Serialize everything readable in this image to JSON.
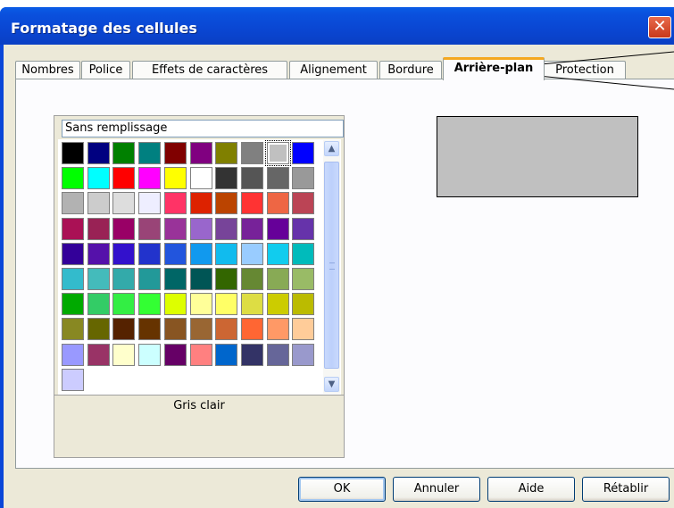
{
  "window": {
    "title": "Formatage des cellules",
    "close_symbol": "✕"
  },
  "tabs": [
    {
      "label": "Nombres",
      "active": false
    },
    {
      "label": "Police",
      "active": false
    },
    {
      "label": "Effets de caractères",
      "active": false
    },
    {
      "label": "Alignement",
      "active": false
    },
    {
      "label": "Bordure",
      "active": false
    },
    {
      "label": "Arrière-plan",
      "active": true
    },
    {
      "label": "Protection",
      "active": false
    }
  ],
  "background_tab": {
    "no_fill_label": "Sans remplissage",
    "selected_color_name": "Gris clair",
    "selected_color_hex": "#c0c0c0",
    "palette": [
      [
        "#000000",
        "#000080",
        "#008000",
        "#008080",
        "#800000",
        "#800080",
        "#808000",
        "#808080",
        "#c0c0c0",
        "#0000ff"
      ],
      [
        "#00ff00",
        "#00ffff",
        "#ff0000",
        "#ff00ff",
        "#ffff00",
        "#ffffff",
        "#333333",
        "#555555",
        "#666666",
        "#999999"
      ],
      [
        "#b2b2b2",
        "#cccccc",
        "#dddddd",
        "#eeeeff",
        "#ff3366",
        "#dd2200",
        "#bb4400",
        "#ff3333",
        "#ee6644",
        "#bb4455"
      ],
      [
        "#aa1155",
        "#992255",
        "#990066",
        "#994477",
        "#993399",
        "#9966cc",
        "#774499",
        "#772299",
        "#660099",
        "#6633aa"
      ],
      [
        "#330099",
        "#5511aa",
        "#3311cc",
        "#2233cc",
        "#2255dd",
        "#1199ee",
        "#11bbee",
        "#99ccff",
        "#11ccee",
        "#00bbbb"
      ],
      [
        "#33bbcc",
        "#44bbbb",
        "#33aaaa",
        "#229999",
        "#006666",
        "#005555",
        "#336600",
        "#668833",
        "#88aa55",
        "#99bb66"
      ],
      [
        "#00aa00",
        "#33cc66",
        "#33ee44",
        "#33ff33",
        "#ddff00",
        "#ffff99",
        "#ffff66",
        "#dddd44",
        "#cccc00",
        "#bbbb00"
      ],
      [
        "#888822",
        "#666600",
        "#552200",
        "#663300",
        "#885522",
        "#996633",
        "#cc6633",
        "#ff6633",
        "#ff9966",
        "#ffcc99"
      ],
      [
        "#9999ff",
        "#993366",
        "#ffffcc",
        "#ccffff",
        "#660066",
        "#ff8080",
        "#0066cc",
        "#333366",
        "#666699",
        "#9999cc"
      ],
      [
        "#ccccff"
      ]
    ]
  },
  "buttons": {
    "ok": "OK",
    "cancel": "Annuler",
    "help": "Aide",
    "reset": "Rétablir"
  }
}
